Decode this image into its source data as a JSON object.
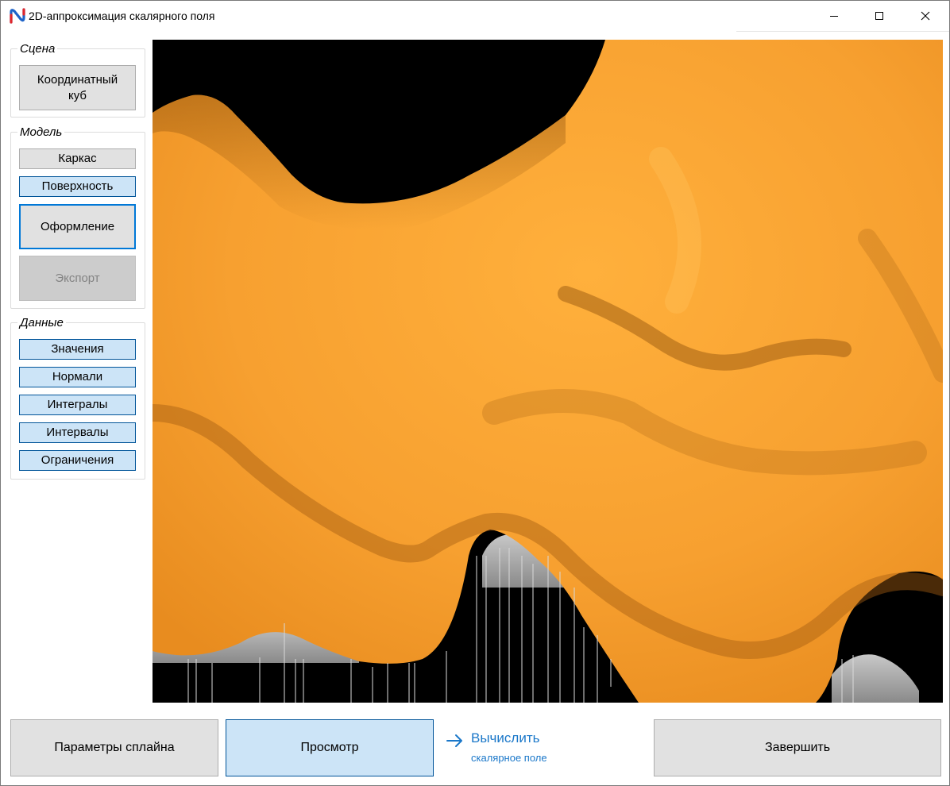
{
  "window": {
    "title": "2D-аппроксимация скалярного поля",
    "controls": [
      "minimize-icon",
      "maximize-icon",
      "close-icon"
    ]
  },
  "sidebar": {
    "scene": {
      "title": "Сцена",
      "coord_cube_line1": "Координатный",
      "coord_cube_line2": "куб"
    },
    "model": {
      "title": "Модель",
      "wireframe": "Каркас",
      "surface": "Поверхность",
      "appearance": "Оформление",
      "export": "Экспорт"
    },
    "data": {
      "title": "Данные",
      "items": [
        "Значения",
        "Нормали",
        "Интегралы",
        "Интервалы",
        "Ограничения"
      ]
    }
  },
  "viewport": {
    "surface_color": "#ffa52f",
    "background_color": "#000000"
  },
  "footer": {
    "spline_params": "Параметры сплайна",
    "preview": "Просмотр",
    "compute_main": "Вычислить",
    "compute_sub": "скалярное поле",
    "finish": "Завершить"
  },
  "colors": {
    "accent_blue": "#0078d7",
    "pressed_blue": "#cce4f7",
    "link_blue": "#1a77c9"
  }
}
